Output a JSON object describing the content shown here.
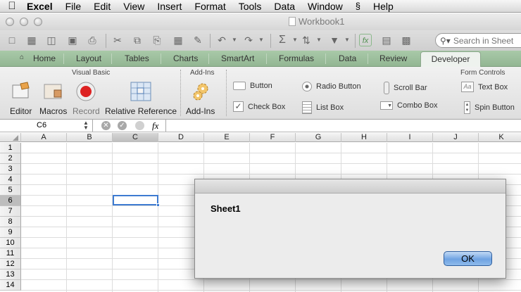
{
  "menubar": {
    "apple_icon": "apple-logo-icon",
    "app_name": "Excel",
    "items": [
      "File",
      "Edit",
      "View",
      "Insert",
      "Format",
      "Tools",
      "Data",
      "Window",
      "Help"
    ],
    "script_icon": "script-menu-icon"
  },
  "window": {
    "title": "Workbook1"
  },
  "toolbar": {
    "search_placeholder": "Search in Sheet"
  },
  "ribbon": {
    "tabs": [
      "Home",
      "Layout",
      "Tables",
      "Charts",
      "SmartArt",
      "Formulas",
      "Data",
      "Review",
      "Developer"
    ],
    "active_tab": "Developer",
    "groups": {
      "visual_basic": {
        "title": "Visual Basic",
        "buttons": [
          "Editor",
          "Macros",
          "Record",
          "Relative Reference"
        ]
      },
      "add_ins": {
        "title": "Add-Ins",
        "buttons": [
          "Add-Ins"
        ]
      },
      "form_controls": {
        "title": "Form Controls",
        "items": [
          "Button",
          "Radio Button",
          "Scroll Bar",
          "Text Box",
          "Check Box",
          "List Box",
          "Combo Box",
          "Spin Button"
        ]
      }
    }
  },
  "formula_bar": {
    "name_box": "C6",
    "fx": "fx",
    "value": ""
  },
  "sheet": {
    "columns": [
      "A",
      "B",
      "C",
      "D",
      "E",
      "F",
      "G",
      "H",
      "I",
      "J",
      "K"
    ],
    "rows": [
      "1",
      "2",
      "3",
      "4",
      "5",
      "6",
      "7",
      "8",
      "9",
      "10",
      "11",
      "12",
      "13",
      "14"
    ],
    "selected_column": "C",
    "selected_row": "6"
  },
  "dialog": {
    "message": "Sheet1",
    "ok_label": "OK"
  }
}
